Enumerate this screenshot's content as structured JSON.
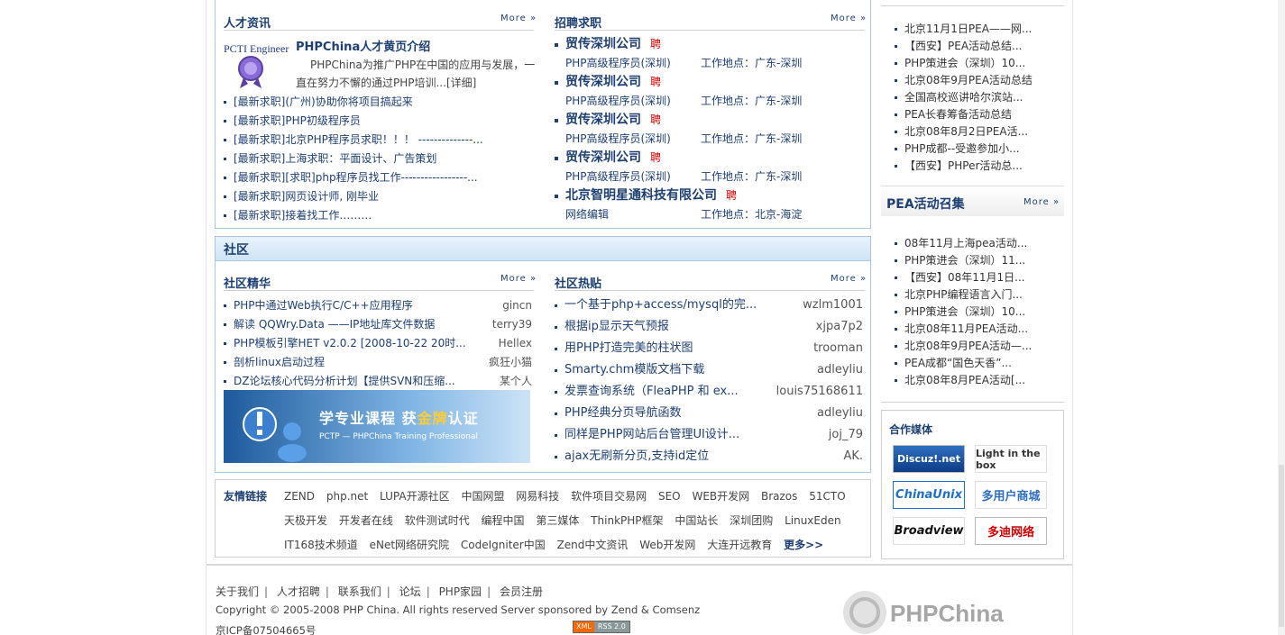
{
  "talent": {
    "title": "人才资讯",
    "more": "More »",
    "feature_title": "PHPChina人才黄页介绍",
    "feature_desc_line1": "PHPChina为推广PHP在中国的应用与发展，一",
    "feature_desc_line2": "直在努力不懈的通过PHP培训...[详细]",
    "logo_text": "PCTI Engineer",
    "items": [
      "[最新求职](广州)协助你将项目搞起来",
      "[最新求职]PHP初级程序员",
      "[最新求职]北京PHP程序员求职！！！ --------------...",
      "[最新求职]上海求职：平面设计、广告策划",
      "[最新求职][求职]php程序员找工作-----------------...",
      "[最新求职]网页设计师, 刚毕业",
      "[最新求职]接着找工作………"
    ]
  },
  "jobs": {
    "title": "招聘求职",
    "more": "More »",
    "pin": "聘",
    "list": [
      {
        "company": "贸传深圳公司",
        "position": "PHP高级程序员(深圳)",
        "location": "工作地点：广东-深圳"
      },
      {
        "company": "贸传深圳公司",
        "position": "PHP高级程序员(深圳)",
        "location": "工作地点：广东-深圳"
      },
      {
        "company": "贸传深圳公司",
        "position": "PHP高级程序员(深圳)",
        "location": "工作地点：广东-深圳"
      },
      {
        "company": "贸传深圳公司",
        "position": "PHP高级程序员(深圳)",
        "location": "工作地点：广东-深圳"
      },
      {
        "company": "北京智明星通科技有限公司",
        "position": "网络编辑",
        "location": "工作地点：北京-海淀"
      }
    ]
  },
  "community": {
    "section_title": "社区",
    "best": {
      "title": "社区精华",
      "more": "More »",
      "items": [
        {
          "text": "PHP中通过Web执行C/C++应用程序",
          "author": "gincn"
        },
        {
          "text": "解读 QQWry.Data ——IP地址库文件数据",
          "author": "terry39"
        },
        {
          "text": "PHP模板引擎HET v2.0.2 [2008-10-22 20时...",
          "author": "Hellex"
        },
        {
          "text": "剖析linux启动过程",
          "author": "疯狂小猫"
        },
        {
          "text": "DZ论坛核心代码分析计划【提供SVN和压缩...",
          "author": "某个人"
        }
      ]
    },
    "hot": {
      "title": "社区热贴",
      "more": "More »",
      "items": [
        {
          "text": "一个基于php+access/mysql的完...",
          "author": "wzlm1001"
        },
        {
          "text": "根据ip显示天气预报",
          "author": "xjpa7p2"
        },
        {
          "text": "用PHP打造完美的柱状图",
          "author": "trooman"
        },
        {
          "text": "Smarty.chm模版文档下载",
          "author": "adleyliu"
        },
        {
          "text": "发票查询系统（FleaPHP 和 ex...",
          "author": "louis75168611"
        },
        {
          "text": "PHP经典分页导航函数",
          "author": "adleyliu"
        },
        {
          "text": "同样是PHP网站后台管理UI设计...",
          "author": "joj_79"
        },
        {
          "text": "ajax无刷新分页,支持id定位",
          "author": "AK."
        }
      ]
    },
    "banner": {
      "main_a": "学专业课程",
      "main_b": "获",
      "main_gold": "金牌",
      "main_c": "认证",
      "sub": "PCTP — PHPChina Training Professional"
    }
  },
  "links": {
    "label": "友情链接",
    "row1": [
      "ZEND",
      "php.net",
      "LUPA开源社区",
      "中国网盟",
      "网易科技",
      "软件项目交易网",
      "SEO",
      "WEB开发网",
      "Brazos",
      "51CTO"
    ],
    "row2": [
      "天极开发",
      "开发者在线",
      "软件测试时代",
      "编程中国",
      "第三媒体",
      "ThinkPHP框架",
      "中国站长",
      "深圳团购",
      "LinuxEden"
    ],
    "row3": [
      "IT168技术频道",
      "eNet网络研究院",
      "CodeIgniter中国",
      "Zend中文资讯",
      "Web开发网",
      "大连开远教育"
    ],
    "more": "更多>>"
  },
  "right": {
    "list1": [
      "北京11月1日PEA——网...",
      "【西安】PEA活动总结...",
      "PHP策进会（深圳）10...",
      "北京08年9月PEA活动总结",
      "全国高校巡讲哈尔滨站...",
      "PEA长春筹备活动总结",
      "北京08年8月2日PEA活...",
      "PHP成都--受邀参加小...",
      "【西安】PHPer活动总..."
    ],
    "pea_title": "PEA活动召集",
    "pea_more": "More »",
    "list2": [
      "08年11月上海pea活动...",
      "PHP策进会（深圳）11...",
      "【西安】08年11月1日...",
      "北京PHP编程语言入门...",
      "PHP策进会（深圳）10...",
      "北京08年11月PEA活动...",
      "北京08年9月PEA活动—...",
      "PEA成都“国色天香”...",
      "北京08年8月PEA活动[..."
    ],
    "media_title": "合作媒体",
    "media": [
      "Discuz!.net",
      "Light in the box",
      "ChinaUnix",
      "多用户商城",
      "Broadview",
      "多迪网络"
    ]
  },
  "footer": {
    "nav": [
      "关于我们",
      "人才招聘",
      "联系我们",
      "论坛",
      "PHP家园",
      "会员注册"
    ],
    "copyright": "Copyright © 2005-2008 PHP China. All rights reserved Server sponsored by Zend & Comsenz",
    "icp": "京ICP备07504665号",
    "rss_a": "XML",
    "rss_b": "RSS 2.0",
    "logo_text": "PHPChina"
  }
}
